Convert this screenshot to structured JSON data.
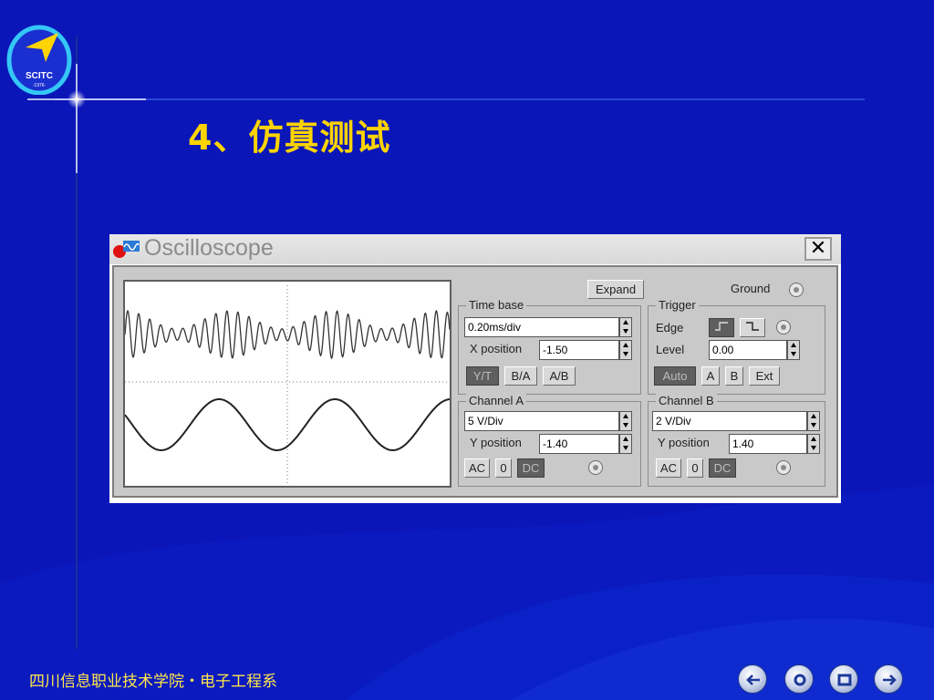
{
  "slide": {
    "title": "4、仿真测试",
    "footer": "四川信息职业技术学院・电子工程系",
    "logo": {
      "text": "SCITC",
      "year": "·1976·"
    },
    "background": "#0a16b8",
    "title_color": "#ffd400"
  },
  "nav": [
    {
      "name": "nav-prev-icon",
      "icon": "arrow-left-icon"
    },
    {
      "name": "nav-home-icon",
      "icon": "circle-icon"
    },
    {
      "name": "nav-menu-icon",
      "icon": "square-icon"
    },
    {
      "name": "nav-next-icon",
      "icon": "arrow-right-icon"
    }
  ],
  "oscilloscope": {
    "window_title": "Oscilloscope",
    "close_label": "✕",
    "expand_label": "Expand",
    "ground_label": "Ground",
    "time_base": {
      "label": "Time base",
      "value": "0.20ms/div",
      "x_position_label": "X position",
      "x_position": "-1.50",
      "modes": [
        "Y/T",
        "B/A",
        "A/B"
      ],
      "active_mode": "Y/T"
    },
    "trigger": {
      "label": "Trigger",
      "edge_label": "Edge",
      "level_label": "Level",
      "level": "0.00",
      "sources": [
        "Auto",
        "A",
        "B",
        "Ext"
      ],
      "active_source": "Auto"
    },
    "channel_a": {
      "label": "Channel A",
      "scale": "5 V/Div",
      "y_position_label": "Y position",
      "y_position": "-1.40",
      "coupling": [
        "AC",
        "0",
        "DC"
      ],
      "active_coupling": "DC"
    },
    "channel_b": {
      "label": "Channel B",
      "scale": "2 V/Div",
      "y_position_label": "Y position",
      "y_position": "1.40",
      "coupling": [
        "AC",
        "0",
        "DC"
      ],
      "active_coupling": "DC"
    }
  }
}
